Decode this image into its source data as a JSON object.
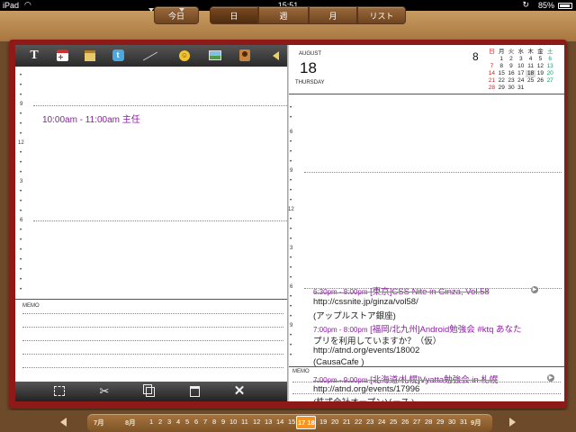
{
  "status_bar": {
    "carrier": "iPad",
    "time": "15:51",
    "battery": "85%"
  },
  "view_tabs": {
    "today": "今日",
    "day": "日",
    "week": "週",
    "month": "月",
    "list": "リスト"
  },
  "left_page": {
    "hour_labels": [
      "6",
      "9",
      "12",
      "3",
      "6"
    ],
    "event": {
      "time": "10:00am - 11:00am",
      "title": "主任"
    },
    "memo_label": "MEMO"
  },
  "right_page": {
    "month_name": "AUGUST",
    "day_number": "18",
    "weekday": "THURSDAY",
    "mini_calendar": {
      "month_number": "8",
      "headers": [
        "日",
        "月",
        "火",
        "水",
        "木",
        "金",
        "土"
      ],
      "weeks": [
        [
          "",
          "1",
          "2",
          "3",
          "4",
          "5",
          "6"
        ],
        [
          "7",
          "8",
          "9",
          "10",
          "11",
          "12",
          "13"
        ],
        [
          "14",
          "15",
          "16",
          "17",
          "18",
          "19",
          "20"
        ],
        [
          "21",
          "22",
          "23",
          "24",
          "25",
          "26",
          "27"
        ],
        [
          "28",
          "29",
          "30",
          "31",
          "",
          "",
          ""
        ]
      ]
    },
    "hour_labels": [
      "6",
      "9",
      "12",
      "3",
      "6",
      "9"
    ],
    "memo_label": "MEMO",
    "events": [
      {
        "time": "6:30pm - 8:00pm",
        "title": "[東京]CSS Nite in Ginza, Vol.58",
        "url": "http://cssnite.jp/ginza/vol58/",
        "place": "(アップルストア銀座)"
      },
      {
        "time": "7:00pm - 8:00pm",
        "title": "[福岡/北九州]Android勉強会 #ktq あなた",
        "line2": "プリを利用していますか？（仮）",
        "url": "http://atnd.org/events/18002",
        "place": "(CausaCafe )"
      },
      {
        "time": "7:00pm - 9:00pm",
        "title": "[北海道/札幌]Vyatta勉強会 in 札幌",
        "url": "http://atnd.org/events/17996",
        "place": "(株式会社オープンソース )"
      }
    ]
  },
  "date_strip": {
    "prev_month": "7月",
    "month": "8月",
    "days": [
      "1",
      "2",
      "3",
      "4",
      "5",
      "6",
      "7",
      "8",
      "9",
      "10",
      "11",
      "12",
      "13",
      "14",
      "15",
      "16",
      "17",
      "18",
      "19",
      "20",
      "21",
      "22",
      "23",
      "24",
      "25",
      "26",
      "27",
      "28",
      "29",
      "30",
      "31"
    ],
    "selected": "17 18",
    "next_month": "9月"
  },
  "colors": {
    "event_text": "#8a1fa0",
    "book_cover": "#8e1a18",
    "selected_strip": "#f7931e"
  }
}
